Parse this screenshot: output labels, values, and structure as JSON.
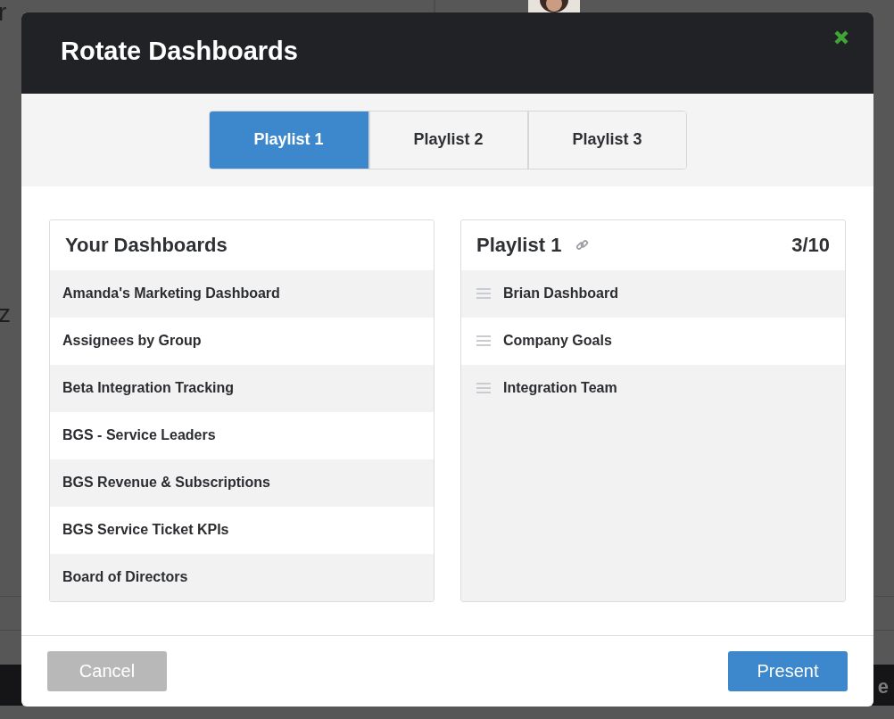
{
  "background_page": {
    "texts": [
      {
        "text": "r",
        "kind": "label"
      },
      {
        "text": "z",
        "kind": "label"
      }
    ],
    "footer_texts": [
      "e"
    ]
  },
  "dialog": {
    "title": "Rotate Dashboards",
    "tabs": [
      {
        "label": "Playlist 1",
        "selected": true
      },
      {
        "label": "Playlist 2",
        "selected": false
      },
      {
        "label": "Playlist 3",
        "selected": false
      }
    ],
    "dashboards_panel": {
      "title": "Your Dashboards",
      "items": [
        "Amanda's Marketing Dashboard",
        "Assignees by Group",
        "Beta Integration Tracking",
        "BGS - Service Leaders",
        "BGS Revenue & Subscriptions",
        "BGS Service Ticket KPIs",
        "Board of Directors"
      ]
    },
    "playlist_panel": {
      "title": "Playlist 1",
      "count": "3/10",
      "items": [
        "Brian Dashboard",
        "Company Goals",
        "Integration Team"
      ]
    },
    "buttons": [
      {
        "label": "Cancel",
        "kind": "secondary",
        "disabled": true
      },
      {
        "label": "Present",
        "kind": "primary",
        "disabled": false
      }
    ]
  }
}
